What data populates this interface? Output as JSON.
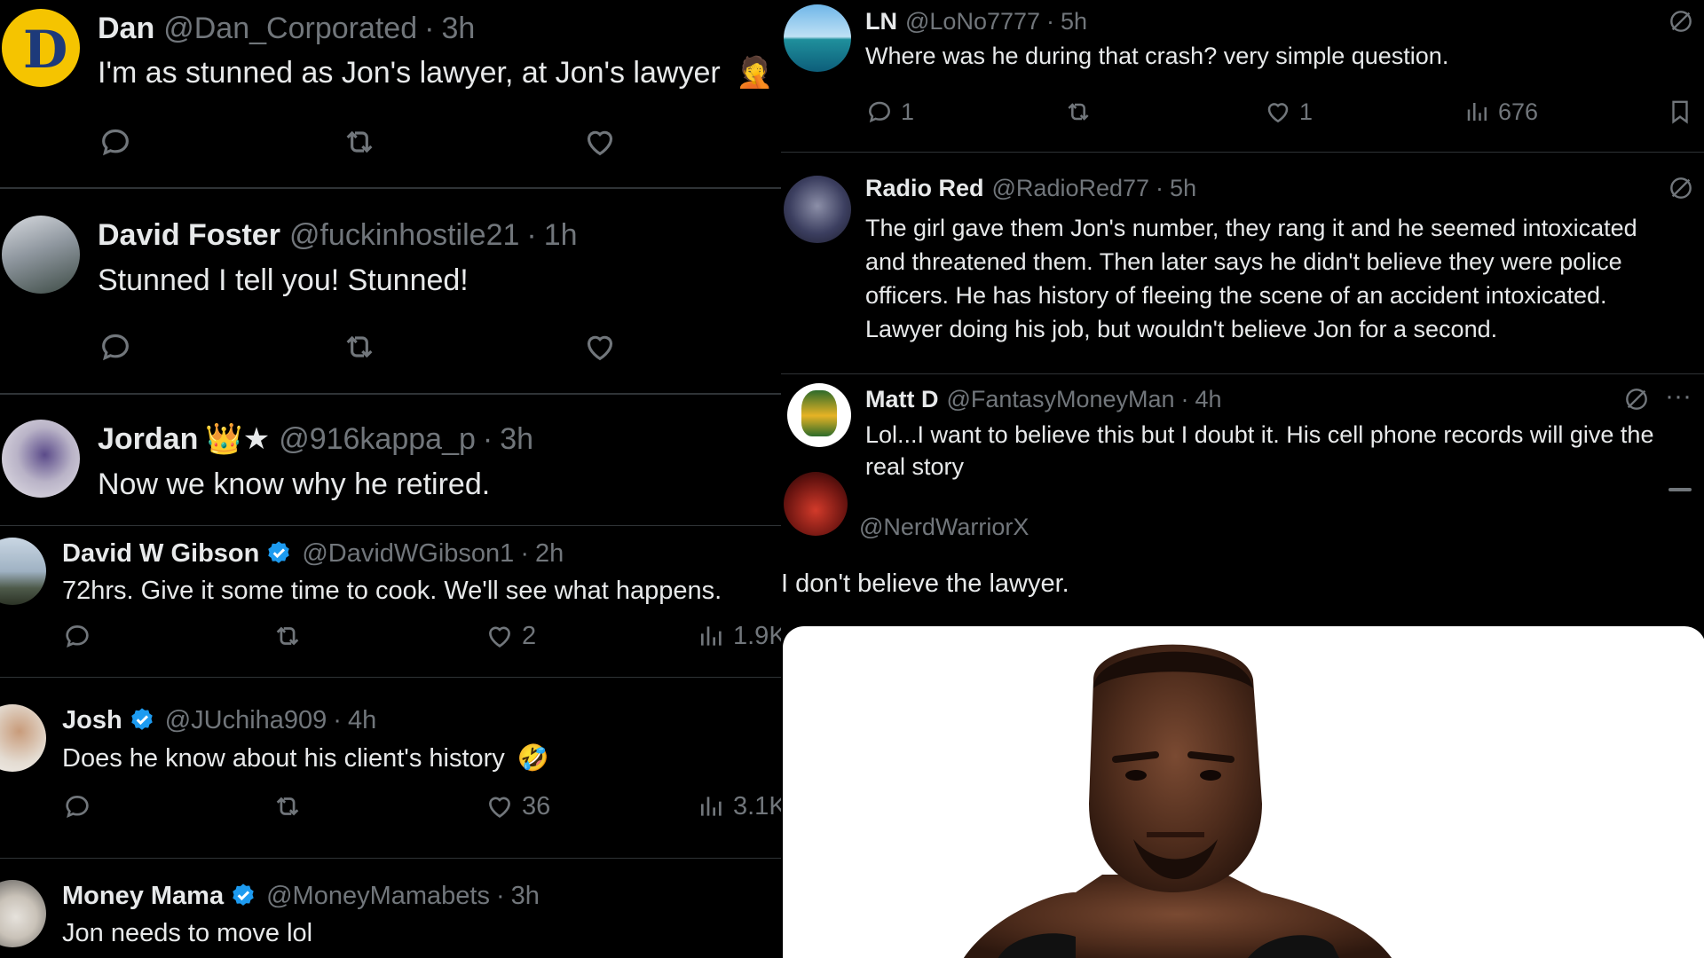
{
  "left_top": [
    {
      "name": "Dan",
      "handle": "@Dan_Corporated",
      "time": "3h",
      "text": "I'm as stunned as Jon's lawyer, at Jon's lawyer",
      "emoji": "🤦"
    },
    {
      "name": "David Foster",
      "handle": "@fuckinhostile21",
      "time": "1h",
      "text": "Stunned I tell you! Stunned!"
    },
    {
      "name": "Jordan",
      "handle": "@916kappa_p",
      "time": "3h",
      "name_suffix": "👑★",
      "text": "Now we know why he retired."
    }
  ],
  "left_bottom": [
    {
      "name": "David W Gibson",
      "handle": "@DavidWGibson1",
      "time": "2h",
      "text": "72hrs. Give it some time to cook. We'll see what happens.",
      "likes": "2",
      "views": "1.9K"
    },
    {
      "name": "Josh",
      "handle": "@JUchiha909",
      "time": "4h",
      "text": "Does he know about his client's history",
      "emoji": "🤣",
      "likes": "36",
      "views": "3.1K"
    },
    {
      "name": "Money Mama",
      "handle": "@MoneyMamabets",
      "time": "3h",
      "text": "Jon needs to move lol"
    }
  ],
  "right": {
    "ln": {
      "name": "LN",
      "handle": "@LoNo7777",
      "time": "5h",
      "text": "Where was he during that crash? very simple question.",
      "replies": "1",
      "likes": "1",
      "views": "676"
    },
    "radio": {
      "name": "Radio Red",
      "handle": "@RadioRed77",
      "time": "5h",
      "lines": [
        "The girl gave them Jon's number, they rang it and he seemed intoxicated",
        "and threatened them. Then later says he didn't believe they were police",
        "officers. He has history of fleeing the scene of an accident intoxicated.",
        "Lawyer doing his job, but wouldn't believe Jon for a second."
      ]
    },
    "matt": {
      "name": "Matt D",
      "handle": "@FantasyMoneyMan",
      "time": "4h",
      "lines": [
        "Lol...I want to believe this but I doubt it. His cell phone records will give the",
        "real story"
      ]
    },
    "nerd": {
      "handle": "@NerdWarriorX",
      "text": "I don't believe the lawyer."
    }
  },
  "colors": {
    "background": "#000000",
    "text": "#e7e9ea",
    "muted": "#71767b",
    "divider": "#2f3336",
    "verified": "#1d9bf0",
    "dan_avatar": "#f5c400"
  }
}
